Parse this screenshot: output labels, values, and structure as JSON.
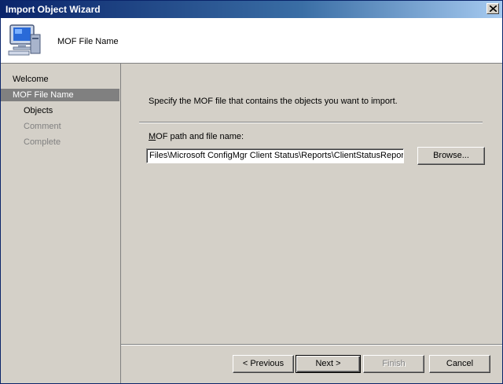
{
  "window": {
    "title": "Import Object Wizard"
  },
  "header": {
    "title": "MOF File Name",
    "icon": "computer-icon"
  },
  "sidebar": {
    "items": [
      {
        "label": "Welcome",
        "state": "normal"
      },
      {
        "label": "MOF File Name",
        "state": "active"
      },
      {
        "label": "Objects",
        "state": "normal"
      },
      {
        "label": "Comment",
        "state": "disabled"
      },
      {
        "label": "Complete",
        "state": "disabled"
      }
    ]
  },
  "main": {
    "instruction": "Specify the MOF file that contains the objects you want to import.",
    "field_label_accel": "M",
    "field_label_rest": "OF path and file name:",
    "path_value": "Files\\Microsoft ConfigMgr Client Status\\Reports\\ClientStatusReports.mof",
    "browse_label": "Browse..."
  },
  "footer": {
    "previous_label": "< Previous",
    "next_label": "Next >",
    "finish_label": "Finish",
    "cancel_label": "Cancel"
  },
  "colors": {
    "titlebar": "#0a246a",
    "active_nav": "#808080",
    "face": "#d4d0c8"
  }
}
